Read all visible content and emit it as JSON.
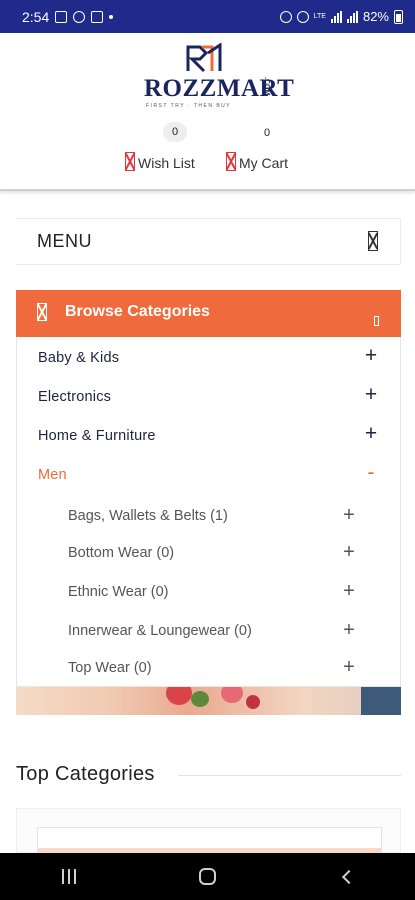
{
  "status_bar": {
    "time": "2:54",
    "battery": "82%",
    "network": "LTE",
    "icons": [
      "gallery-icon",
      "whatsapp-icon",
      "instagram-icon",
      "alarm-icon",
      "hotspot-icon",
      "volte-icon",
      "signal-icon",
      "battery-icon"
    ]
  },
  "header": {
    "logo_text": "ROZZMART",
    "logo_suffix": ".COM",
    "logo_tagline": "FIRST TRY · THEN BUY",
    "wishlist": {
      "label": "Wish List",
      "count": "0"
    },
    "cart": {
      "label": "My Cart",
      "count": "0"
    }
  },
  "menu": {
    "label": "MENU"
  },
  "browse": {
    "label": "Browse Categories"
  },
  "categories": [
    {
      "label": "Baby & Kids",
      "toggle": "+"
    },
    {
      "label": "Electronics",
      "toggle": "+"
    },
    {
      "label": "Home & Furniture",
      "toggle": "+"
    },
    {
      "label": "Men",
      "toggle": "-"
    }
  ],
  "subcategories": [
    {
      "label": "Bags, Wallets & Belts (1)",
      "toggle": "+"
    },
    {
      "label": "Bottom Wear (0)",
      "toggle": "+"
    },
    {
      "label": "Ethnic Wear (0)",
      "toggle": "+"
    },
    {
      "label": "Innerwear & Loungewear (0)",
      "toggle": "+"
    },
    {
      "label": "Top Wear (0)",
      "toggle": "+"
    }
  ],
  "top_categories": {
    "title": "Top Categories"
  },
  "colors": {
    "accent": "#ef6a3c",
    "status_bar": "#1f2a8a",
    "brand_navy": "#1a2560",
    "icon_red": "#e0373b"
  }
}
